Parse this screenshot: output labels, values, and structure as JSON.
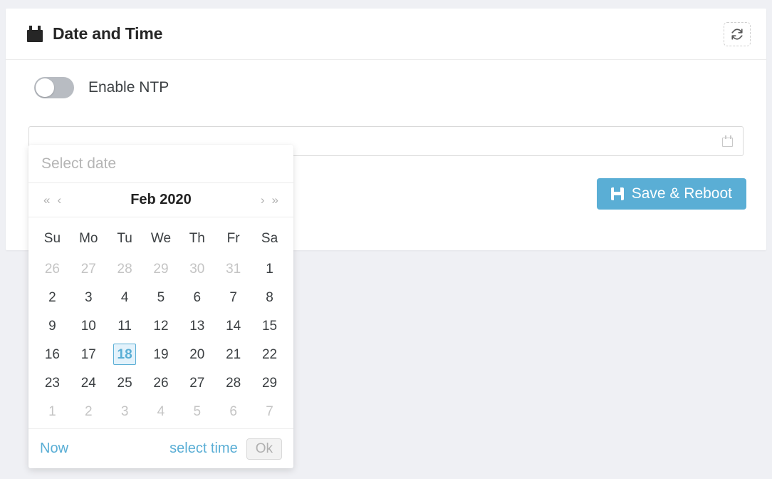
{
  "card": {
    "title": "Date and Time",
    "title_icon": "calendar-icon",
    "refresh_icon": "refresh-icon"
  },
  "settings": {
    "ntp_label": "Enable NTP",
    "ntp_enabled": false,
    "date_input_value": "",
    "date_input_placeholder": "",
    "date_input_icon": "calendar-icon"
  },
  "actions": {
    "save_label": "Save & Reboot",
    "save_icon": "floppy-save-icon",
    "save_color": "#5aaed5"
  },
  "datepicker": {
    "input_placeholder": "Select date",
    "nav": {
      "prev_year": "«",
      "prev_month": "‹",
      "next_month": "›",
      "next_year": "»"
    },
    "title": "Feb 2020",
    "weekdays": [
      "Su",
      "Mo",
      "Tu",
      "We",
      "Th",
      "Fr",
      "Sa"
    ],
    "weeks": [
      [
        {
          "d": "26",
          "muted": true
        },
        {
          "d": "27",
          "muted": true
        },
        {
          "d": "28",
          "muted": true
        },
        {
          "d": "29",
          "muted": true
        },
        {
          "d": "30",
          "muted": true
        },
        {
          "d": "31",
          "muted": true
        },
        {
          "d": "1",
          "muted": false
        }
      ],
      [
        {
          "d": "2",
          "muted": false
        },
        {
          "d": "3",
          "muted": false
        },
        {
          "d": "4",
          "muted": false
        },
        {
          "d": "5",
          "muted": false
        },
        {
          "d": "6",
          "muted": false
        },
        {
          "d": "7",
          "muted": false
        },
        {
          "d": "8",
          "muted": false
        }
      ],
      [
        {
          "d": "9",
          "muted": false
        },
        {
          "d": "10",
          "muted": false
        },
        {
          "d": "11",
          "muted": false
        },
        {
          "d": "12",
          "muted": false
        },
        {
          "d": "13",
          "muted": false
        },
        {
          "d": "14",
          "muted": false
        },
        {
          "d": "15",
          "muted": false
        }
      ],
      [
        {
          "d": "16",
          "muted": false
        },
        {
          "d": "17",
          "muted": false
        },
        {
          "d": "18",
          "muted": false,
          "selected": true
        },
        {
          "d": "19",
          "muted": false
        },
        {
          "d": "20",
          "muted": false
        },
        {
          "d": "21",
          "muted": false
        },
        {
          "d": "22",
          "muted": false
        }
      ],
      [
        {
          "d": "23",
          "muted": false
        },
        {
          "d": "24",
          "muted": false
        },
        {
          "d": "25",
          "muted": false
        },
        {
          "d": "26",
          "muted": false
        },
        {
          "d": "27",
          "muted": false
        },
        {
          "d": "28",
          "muted": false
        },
        {
          "d": "29",
          "muted": false
        }
      ],
      [
        {
          "d": "1",
          "muted": true
        },
        {
          "d": "2",
          "muted": true
        },
        {
          "d": "3",
          "muted": true
        },
        {
          "d": "4",
          "muted": true
        },
        {
          "d": "5",
          "muted": true
        },
        {
          "d": "6",
          "muted": true
        },
        {
          "d": "7",
          "muted": true
        }
      ]
    ],
    "footer": {
      "now_label": "Now",
      "select_time_label": "select time",
      "ok_label": "Ok",
      "ok_disabled": true
    },
    "accent_color": "#5aaed5",
    "selected_bg": "#e3f2fb"
  }
}
